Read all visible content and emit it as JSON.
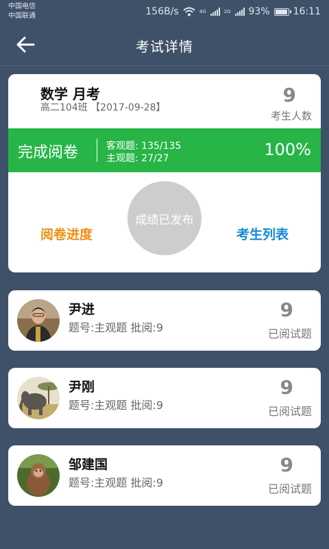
{
  "status_bar": {
    "carrier1": "中国电信",
    "carrier2": "中国联通",
    "speed": "156B/s",
    "net1": "4G",
    "net2": "2G",
    "battery": "93%",
    "time": "16:11"
  },
  "header": {
    "title": "考试详情"
  },
  "exam": {
    "name": "数学 月考",
    "class_date": "高二104班 【2017-09-28】",
    "student_count": "9",
    "student_count_label": "考生人数",
    "status": "完成阅卷",
    "objective": "客观题: 135/135",
    "subjective": "主观题: 27/27",
    "percent": "100%",
    "progress_link": "阅卷进度",
    "publish_label": "成绩已发布",
    "students_link": "考生列表"
  },
  "graders": [
    {
      "name": "尹进",
      "meta": "题号:主观题 批阅:9",
      "count": "9",
      "count_label": "已阅试题"
    },
    {
      "name": "尹刚",
      "meta": "题号:主观题 批阅:9",
      "count": "9",
      "count_label": "已阅试题"
    },
    {
      "name": "邹建国",
      "meta": "题号:主观题 批阅:9",
      "count": "9",
      "count_label": "已阅试题"
    }
  ],
  "colors": {
    "background": "#3e5168",
    "complete_green": "#27b548",
    "progress_orange": "#ef8f14",
    "list_blue": "#168ad6"
  },
  "icons": [
    "wifi-icon",
    "signal-icon",
    "battery-icon",
    "back-arrow-icon"
  ]
}
